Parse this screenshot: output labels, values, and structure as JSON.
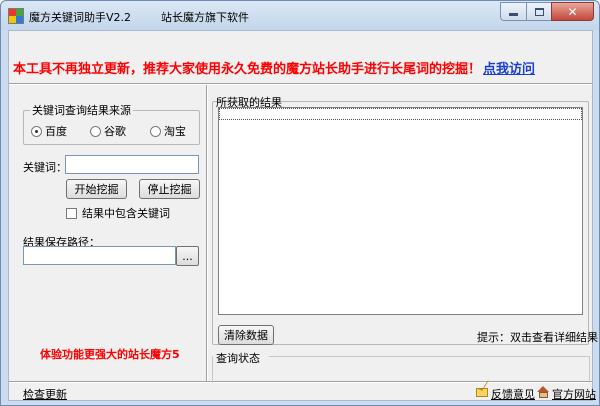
{
  "window": {
    "title": "魔方关键词助手V2.2",
    "subtitle": "站长魔方旗下软件"
  },
  "notice": {
    "text": "本工具不再独立更新，推荐大家使用永久免费的魔方站长助手进行长尾词的挖掘！",
    "link": "点我访问"
  },
  "source_group": {
    "title": "关键词查询结果来源",
    "options": [
      {
        "label": "百度",
        "selected": true
      },
      {
        "label": "谷歌",
        "selected": false
      },
      {
        "label": "淘宝",
        "selected": false
      }
    ]
  },
  "keyword": {
    "label": "关键词：",
    "value": ""
  },
  "buttons": {
    "start": "开始挖掘",
    "stop": "停止挖掘",
    "browse": "...",
    "clear": "清除数据"
  },
  "include_keyword": {
    "label": "结果中包含关键词",
    "checked": false
  },
  "save_path": {
    "label": "结果保存路径：",
    "value": ""
  },
  "promo": "体验功能更强大的站长魔方5",
  "results": {
    "title": "所获取的结果",
    "items": [],
    "hint": "提示：双击查看详细结果"
  },
  "query_status": {
    "title": "查询状态"
  },
  "footer": {
    "check_update": "检查更新",
    "feedback": "反馈意见",
    "website": "官方网站"
  }
}
